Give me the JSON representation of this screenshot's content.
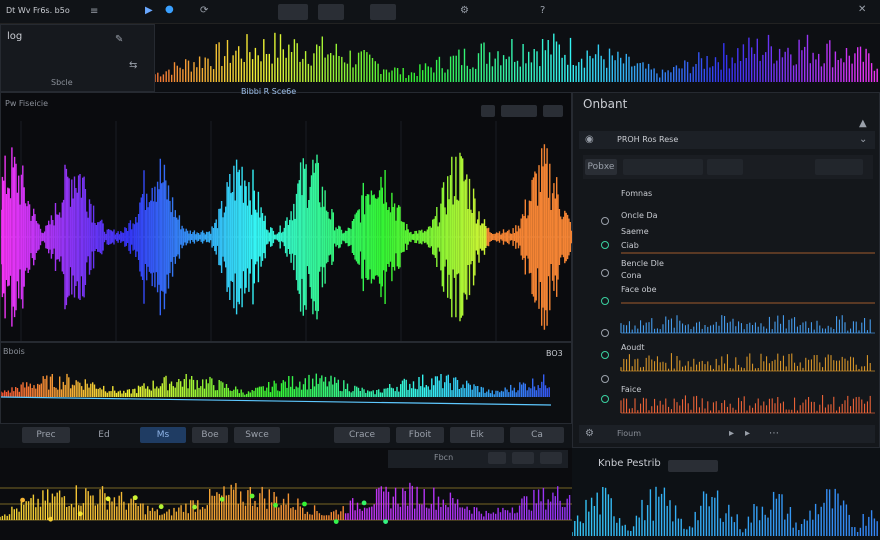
{
  "topbar": {
    "title": "Dt Wv Fr6s. b5o",
    "menu_icon": "ra"
  },
  "left_header": {
    "title": "log",
    "subtitle": "Sbcle"
  },
  "main_waveform": {
    "tab_label": "Bibbi R Sce6e",
    "header": "Pw Fiseicie",
    "level_label": "Bbois",
    "zoom_label": "BO3"
  },
  "transport": {
    "buttons": [
      "Prec",
      "Ed",
      "Ms",
      "Boe",
      "Swce",
      "",
      "Crace",
      "Fboit",
      "Eik",
      "Ca"
    ]
  },
  "right_panel": {
    "title": "Onbant",
    "section": "PROH Ros Rese",
    "tab": "Pobxe",
    "rows": [
      {
        "label": "Fomnas"
      },
      {
        "label": "Oncle Da"
      },
      {
        "label": "Saeme"
      },
      {
        "label": "Ciab"
      },
      {
        "label": "Bencle Dle"
      },
      {
        "label": "Cona"
      },
      {
        "label": "Face obe"
      },
      {
        "label": "Aoudt"
      },
      {
        "label": "Faice"
      }
    ],
    "footer_label": "Fioum"
  },
  "bottom_right": {
    "title": "Knbe Pestrib"
  },
  "bottom_left": {
    "label": "Fbcn"
  },
  "colors": {
    "accent_blue": "#3aa0ff",
    "accent_orange": "#ff7a2a",
    "accent_green": "#52e06a",
    "accent_purple": "#b44cff",
    "panel_bg": "#16191e"
  }
}
